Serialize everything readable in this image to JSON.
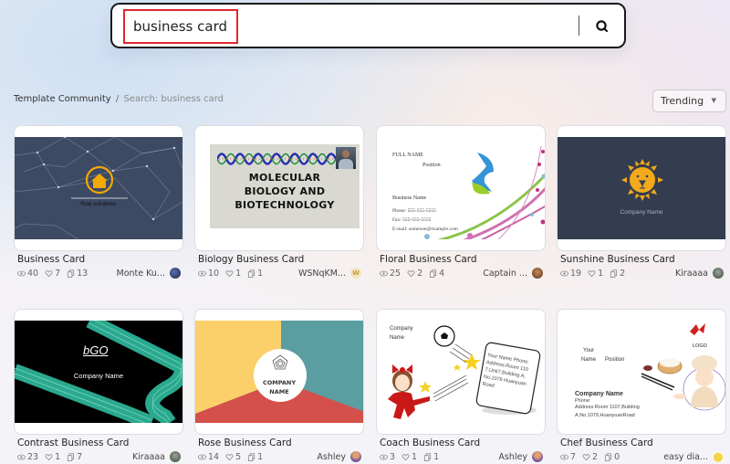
{
  "search": {
    "value": "business card",
    "button_icon": "search-icon"
  },
  "breadcrumb": {
    "root": "Template Community",
    "separator": "/",
    "current": "Search: business card"
  },
  "sort": {
    "selected": "Trending"
  },
  "templates": [
    {
      "title": "Business Card",
      "views": "40",
      "likes": "7",
      "copies": "13",
      "author": "Monte Ku...",
      "avatar_color": "#2c3a6e",
      "preview": {
        "text": "Roe solutions"
      }
    },
    {
      "title": "Biology Business Card",
      "views": "10",
      "likes": "1",
      "copies": "1",
      "author": "WSNqKM...",
      "avatar_color": "#f6e4c0",
      "avatar_letter": "W",
      "preview": {
        "line1": "MOLECULAR",
        "line2": "BIOLOGY AND",
        "line3": "BIOTECHNOLOGY"
      }
    },
    {
      "title": "Floral Business Card",
      "views": "25",
      "likes": "2",
      "copies": "4",
      "author": "Captain ...",
      "avatar_color": "#8a5a3a",
      "preview": {
        "name": "FULL NAME",
        "position": "Position",
        "business": "Business Name",
        "phone": "Phone: 555-555-5555",
        "fax": "Fax: 555-555-5555",
        "email": "E-mail: someone@example.com"
      }
    },
    {
      "title": "Sunshine Business Card",
      "views": "19",
      "likes": "1",
      "copies": "2",
      "author": "Kiraaaa",
      "avatar_color": "#556655",
      "preview": {
        "text": "Company Name"
      }
    },
    {
      "title": "Contrast Business Card",
      "views": "23",
      "likes": "1",
      "copies": "7",
      "author": "Kiraaaa",
      "avatar_color": "#556655",
      "preview": {
        "logo": "bGO",
        "text": "Company Name"
      }
    },
    {
      "title": "Rose Business Card",
      "views": "14",
      "likes": "5",
      "copies": "1",
      "author": "Ashley",
      "avatar_color": "#6a4fa0",
      "preview": {
        "line1": "COMPANY",
        "line2": "NAME"
      }
    },
    {
      "title": "Coach Business Card",
      "views": "3",
      "likes": "1",
      "copies": "1",
      "author": "Ashley",
      "avatar_color": "#6a4fa0",
      "preview": {
        "line1": "Company",
        "line2": "Name",
        "card_text": "Your Name Phone: Address:Room 1107,Unit7,Building A,No.1079 HuanyuanRoad"
      }
    },
    {
      "title": "Chef Business Card",
      "views": "7",
      "likes": "2",
      "copies": "0",
      "author": "easy dia...",
      "avatar_color": "#f2c744",
      "preview": {
        "your": "Your",
        "name": "Name",
        "position": "Position",
        "logo": "LOGO",
        "company": "Company Name",
        "phone": "Phone:",
        "address": "Address:Room 1107,Building",
        "address2": "A,No.1079,HuanyuanRoad"
      }
    }
  ]
}
